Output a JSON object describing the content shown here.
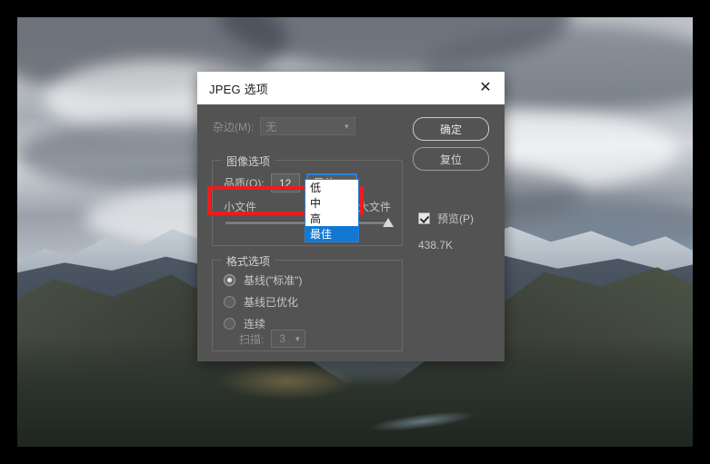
{
  "dialog": {
    "title": "JPEG 选项",
    "close_icon": "close-icon",
    "matte": {
      "label": "杂边(M):",
      "value": "无",
      "caret_icon": "chevron-down-icon"
    },
    "image_options": {
      "legend": "图像选项",
      "quality_label": "品质(Q):",
      "quality_value": "12",
      "quality_preset": "最佳",
      "caret_icon": "chevron-down-icon",
      "slider_min_label": "小文件",
      "slider_max_label": "大文件"
    },
    "format_options": {
      "legend": "格式选项",
      "radios": [
        {
          "label": "基线(\"标准\")",
          "checked": true
        },
        {
          "label": "基线已优化",
          "checked": false
        },
        {
          "label": "连续",
          "checked": false
        }
      ],
      "scan_label": "扫描:",
      "scan_value": "3",
      "scan_caret_icon": "chevron-down-icon"
    },
    "actions": {
      "ok_label": "确定",
      "reset_label": "复位",
      "preview_label": "预览(P)",
      "preview_checked": true,
      "file_size": "438.7K"
    },
    "quality_dropdown": {
      "open": true,
      "options": [
        "低",
        "中",
        "高",
        "最佳"
      ],
      "selected": "最佳"
    },
    "colors": {
      "dialog_bg": "#535353",
      "titlebar_bg": "#ffffff",
      "accent_blue": "#1278d4",
      "focus_blue": "#2a7fd4",
      "annotation_red": "#ee1c1c"
    }
  }
}
